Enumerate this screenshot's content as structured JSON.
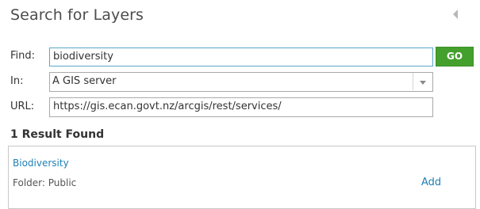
{
  "panel": {
    "title": "Search for Layers"
  },
  "form": {
    "find_label": "Find:",
    "find_value": "biodiversity",
    "go_label": "GO",
    "in_label": "In:",
    "in_value": "A GIS server",
    "url_label": "URL:",
    "url_value": "https://gis.ecan.govt.nz/arcgis/rest/services/"
  },
  "results": {
    "heading": "1 Result Found",
    "items": [
      {
        "name": "Biodiversity",
        "folder": "Folder: Public",
        "action": "Add"
      }
    ]
  },
  "colors": {
    "go_button": "#43a02c",
    "link": "#1e7fb6",
    "focus_border": "#5aa7c8"
  },
  "icons": {
    "collapse": "collapse-arrow-icon",
    "dropdown": "chevron-down-icon"
  }
}
